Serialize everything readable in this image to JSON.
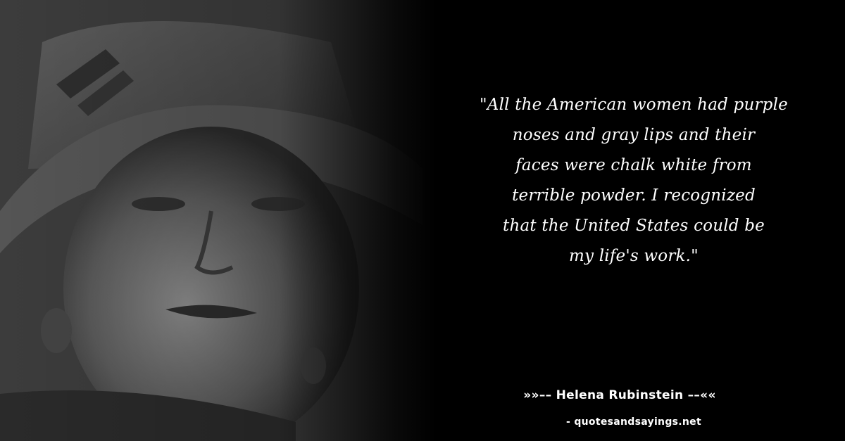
{
  "quote": {
    "lines": [
      "\"All the American women had purple",
      "noses and gray lips and their",
      "faces were chalk white from",
      "terrible powder. I recognized",
      "that the United States could be",
      "my life's work.\""
    ]
  },
  "attribution": {
    "author": "»»–– Helena Rubinstein ––««",
    "site": "- quotesandsayings.net"
  },
  "colors": {
    "background": "#000000",
    "text": "#ffffff"
  }
}
